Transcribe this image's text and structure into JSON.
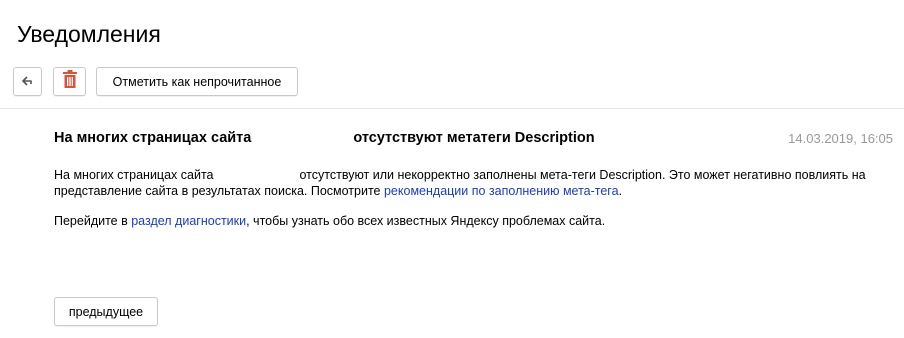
{
  "header": {
    "title": "Уведомления"
  },
  "toolbar": {
    "back_icon": "reply-arrow-icon",
    "delete_icon": "trash-icon",
    "delete_color": "#d9533b",
    "mark_unread_label": "Отметить как непрочитанное"
  },
  "message": {
    "subject_part1": "На многих страницах сайта",
    "subject_part2": "отсутствуют метатеги Description",
    "date": "14.03.2019, 16:05",
    "body1_part1": "На многих страницах сайта",
    "body1_part2": "отсутствуют или некорректно заполнены мета-теги Description. Это может негативно повлиять на представление сайта в результатах поиска. Посмотрите",
    "body1_link": "рекомендации по заполнению мета-тега",
    "body1_end": ".",
    "body2_part1": "Перейдите в",
    "body2_link": "раздел диагностики",
    "body2_part2": ", чтобы узнать обо всех известных Яндексу проблемах сайта.",
    "link_color": "#1a3dc1"
  },
  "footer": {
    "prev_label": "предыдущее"
  }
}
